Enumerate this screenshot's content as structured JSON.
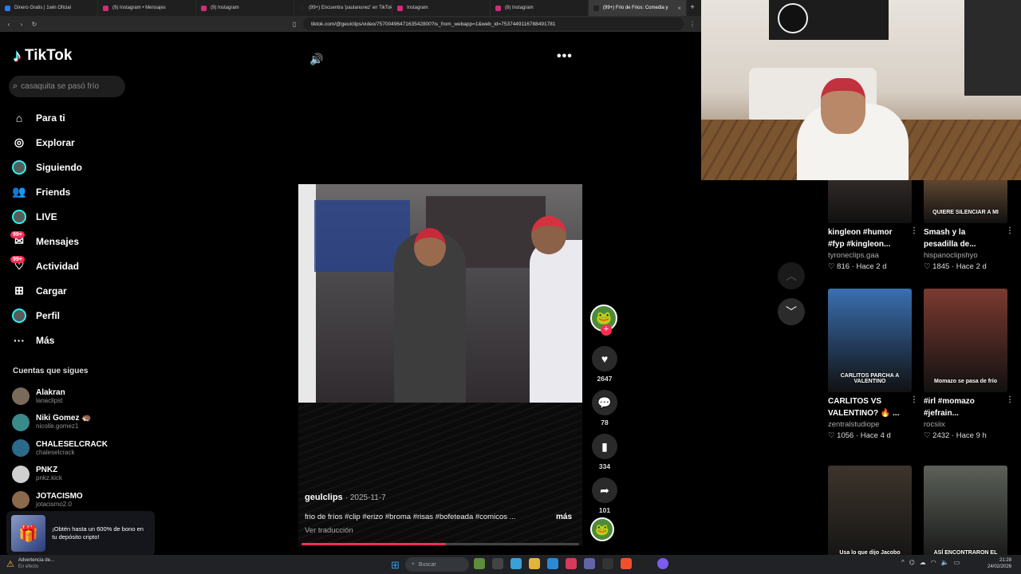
{
  "browser": {
    "tabs": [
      {
        "label": "Dinero Gratis | 1win Oficial",
        "color": "#2b7bf2"
      },
      {
        "label": "(9) Instagram • Mensajes",
        "color": "#d6297a"
      },
      {
        "label": "(9) Instagram",
        "color": "#d6297a"
      },
      {
        "label": "(99+) Encuentra 'paulanunez' en TikTok",
        "color": "#222222"
      },
      {
        "label": "Instagram",
        "color": "#d6297a"
      },
      {
        "label": "(8) Instagram",
        "color": "#d6297a"
      },
      {
        "label": "(99+) Frio de Frios: Comedia y",
        "color": "#222222"
      }
    ],
    "url": "tiktok.com/@geulclips/video/7570049647163542800?is_from_webapp=1&web_id=7537449116788491781"
  },
  "sidebar": {
    "logo": "TikTok",
    "search_placeholder": "casaquita se pasó frío",
    "nav": [
      {
        "label": "Para ti",
        "icon": "home-icon",
        "glyph": "⌂"
      },
      {
        "label": "Explorar",
        "icon": "compass-icon",
        "glyph": "◎"
      },
      {
        "label": "Siguiendo",
        "icon": "following-avatar-icon",
        "glyph": "●"
      },
      {
        "label": "Friends",
        "icon": "friends-icon",
        "glyph": "👥"
      },
      {
        "label": "LIVE",
        "icon": "live-icon",
        "glyph": "●"
      },
      {
        "label": "Mensajes",
        "icon": "messages-icon",
        "glyph": "✉",
        "badge": "99+"
      },
      {
        "label": "Actividad",
        "icon": "activity-icon",
        "glyph": "♡",
        "badge": "99+"
      },
      {
        "label": "Cargar",
        "icon": "upload-icon",
        "glyph": "⊞"
      },
      {
        "label": "Perfil",
        "icon": "profile-icon",
        "glyph": "●"
      },
      {
        "label": "Más",
        "icon": "more-icon",
        "glyph": "···"
      }
    ],
    "following_title": "Cuentas que sigues",
    "following": [
      {
        "name": "Alakran",
        "handle": "lanaclipst"
      },
      {
        "name": "Niki Gomez 🦔",
        "handle": "nicolle.gomez1"
      },
      {
        "name": "CHALESELCRACK",
        "handle": "chaleselcrack"
      },
      {
        "name": "PNKZ",
        "handle": "pnkz.kick"
      },
      {
        "name": "JOTACISMO",
        "handle": "jotacismo2.0"
      }
    ],
    "promo": "¡Obtén hasta un 600% de bono en tu depósito cripto!"
  },
  "video": {
    "author": "geulclips",
    "date": "· 2025-11-7",
    "caption": "frio de fríos #clip #erizo #broma #risas #bofeteada #comicos ...",
    "more": "más",
    "translate": "Ver traducción",
    "progress": 0.52,
    "likes": "2647",
    "comments": "78",
    "saves": "334",
    "shares": "101"
  },
  "suggested": [
    {
      "title": "kingleon #humor #fyp #kingleon...",
      "author": "tyroneclips.gaa",
      "likes": "816",
      "ago": "Hace 2 d",
      "thumb_text": "",
      "color": "#5a4a46"
    },
    {
      "title": "Smash y la pesadilla de...",
      "author": "hispanoclipshyo",
      "likes": "1845",
      "ago": "Hace 2 d",
      "thumb_text": "QUIERE SILENCIAR A MI",
      "color": "#c9905e"
    },
    {
      "title": "CARLITOS VS VALENTINO? 🔥 ...",
      "author": "zentralstudiope",
      "likes": "1056",
      "ago": "Hace 4 d",
      "thumb_text": "CARLITOS PARCHA A VALENTINO",
      "color": "#3a6fb0"
    },
    {
      "title": "#irl #momazo #jefrain...",
      "author": "rocsiix",
      "likes": "2432",
      "ago": "Hace 9 h",
      "thumb_text": "Momazo se pasa de frío",
      "color": "#7a3a30"
    },
    {
      "title": "",
      "author": "",
      "likes": "",
      "ago": "",
      "thumb_text": "Usa lo que dijo Jacobo grinberg para tu vida.",
      "color": "#3d342c"
    },
    {
      "title": "",
      "author": "",
      "likes": "",
      "ago": "",
      "thumb_text": "ASÍ ENCONTRARON EL LUGAR DEL ASALTO",
      "color": "#5b6058"
    }
  ],
  "taskbar": {
    "warning_title": "Advertencia de...",
    "warning_sub": "En efecto",
    "search": "Buscar",
    "time": "21:28",
    "date": "24/02/2026"
  }
}
